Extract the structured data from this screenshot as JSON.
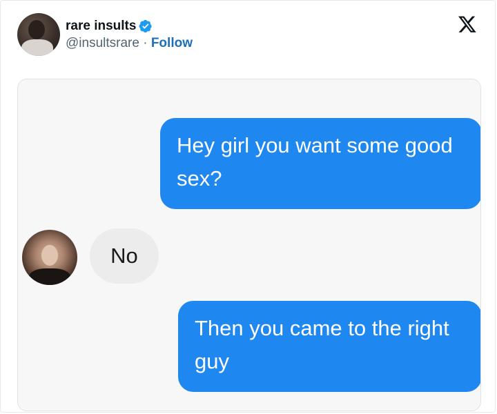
{
  "post": {
    "author": {
      "display_name": "rare insults",
      "handle": "@insultsrare",
      "separator": " · ",
      "follow_label": "Follow",
      "verified": true,
      "avatar_icon": "profile-photo-icon"
    },
    "platform_icon": "x-logo-icon",
    "colors": {
      "verified_badge": "#1d9bf0",
      "follow_link": "#1d6fb8",
      "outgoing_bubble": "#1f87f0",
      "incoming_bubble": "#ececec"
    }
  },
  "conversation": {
    "messages": [
      {
        "direction": "outgoing",
        "text": "Hey girl you want some good sex?"
      },
      {
        "direction": "incoming",
        "text": "No",
        "avatar_icon": "contact-photo-icon"
      },
      {
        "direction": "outgoing",
        "text": "Then you came to the right guy"
      }
    ]
  }
}
